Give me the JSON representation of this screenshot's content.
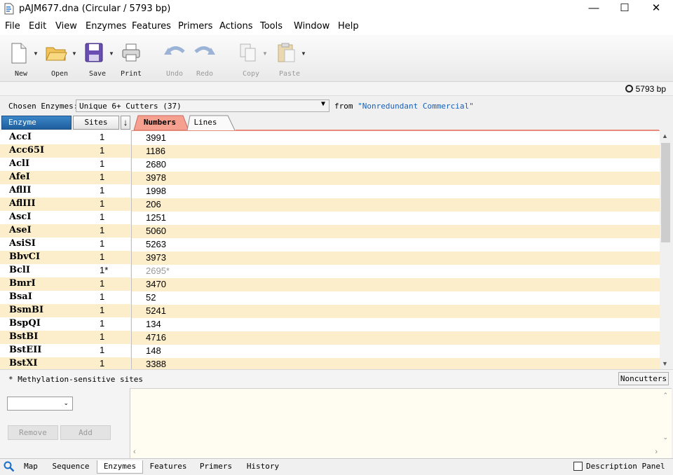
{
  "window": {
    "title": "pAJM677.dna  (Circular / 5793 bp)",
    "min": "—",
    "max": "☐",
    "close": "✕"
  },
  "menu": [
    "File",
    "Edit",
    "View",
    "Enzymes",
    "Features",
    "Primers",
    "Actions",
    "Tools",
    "Window",
    "Help"
  ],
  "toolbar": {
    "new": "New",
    "open": "Open",
    "save": "Save",
    "print": "Print",
    "undo": "Undo",
    "redo": "Redo",
    "copy": "Copy",
    "paste": "Paste"
  },
  "status": {
    "length": "5793 bp"
  },
  "chosen": {
    "label": "Chosen Enzymes:",
    "value": "Unique 6+ Cutters  (37)",
    "from": "from",
    "source": "\"Nonredundant Commercial\""
  },
  "headers": {
    "enzyme": "Enzyme",
    "sites": "Sites",
    "sort": "↓",
    "numbers": "Numbers",
    "lines": "Lines"
  },
  "enzymes": [
    {
      "name": "AccI",
      "sites": "1",
      "pos": "3991"
    },
    {
      "name": "Acc65I",
      "sites": "1",
      "pos": "1186"
    },
    {
      "name": "AclI",
      "sites": "1",
      "pos": "2680"
    },
    {
      "name": "AfeI",
      "sites": "1",
      "pos": "3978"
    },
    {
      "name": "AflII",
      "sites": "1",
      "pos": "1998"
    },
    {
      "name": "AflIII",
      "sites": "1",
      "pos": "206"
    },
    {
      "name": "AscI",
      "sites": "1",
      "pos": "1251"
    },
    {
      "name": "AseI",
      "sites": "1",
      "pos": "5060"
    },
    {
      "name": "AsiSI",
      "sites": "1",
      "pos": "5263"
    },
    {
      "name": "BbvCI",
      "sites": "1",
      "pos": "3973"
    },
    {
      "name": "BclI",
      "sites": "1*",
      "pos": "2695*"
    },
    {
      "name": "BmrI",
      "sites": "1",
      "pos": "3470"
    },
    {
      "name": "BsaI",
      "sites": "1",
      "pos": "52"
    },
    {
      "name": "BsmBI",
      "sites": "1",
      "pos": "5241"
    },
    {
      "name": "BspQI",
      "sites": "1",
      "pos": "134"
    },
    {
      "name": "BstBI",
      "sites": "1",
      "pos": "4716"
    },
    {
      "name": "BstEII",
      "sites": "1",
      "pos": "148"
    },
    {
      "name": "BstXI",
      "sites": "1",
      "pos": "3388"
    }
  ],
  "footnote": "* Methylation-sensitive sites",
  "noncutters": "Noncutters",
  "lower": {
    "remove": "Remove",
    "add": "Add"
  },
  "bottom_tabs": [
    "Map",
    "Sequence",
    "Enzymes",
    "Features",
    "Primers",
    "History"
  ],
  "description_panel": "Description Panel",
  "colors": {
    "row_alt": "#fdeecb",
    "tab_active": "#f39a8a",
    "header_active": "#2a70b3"
  }
}
